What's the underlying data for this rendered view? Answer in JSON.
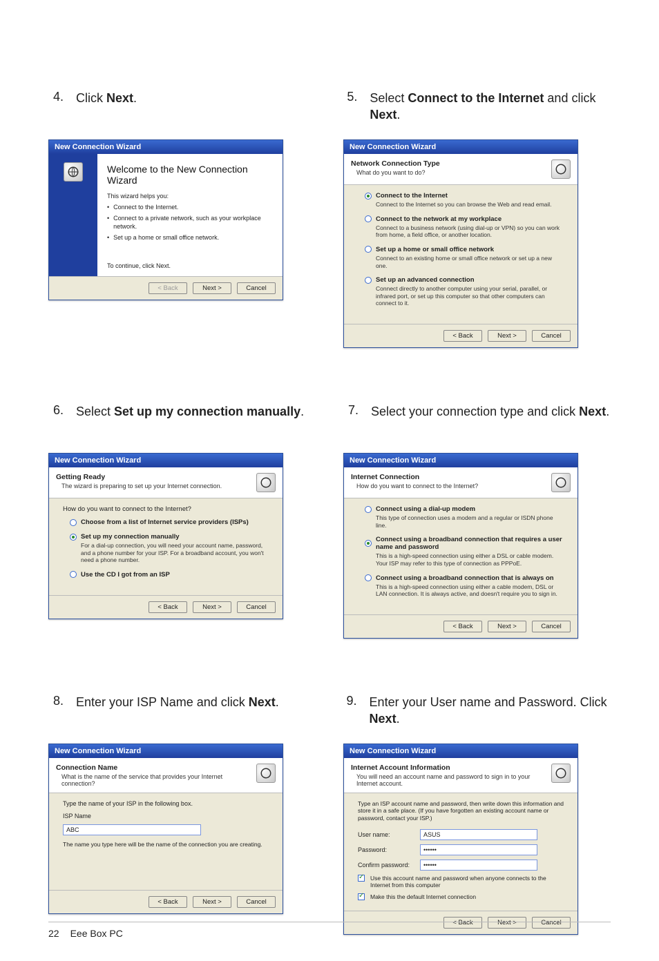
{
  "footer": {
    "page": "22",
    "title": "Eee Box PC"
  },
  "buttons": {
    "back": "< Back",
    "next": "Next >",
    "cancel": "Cancel"
  },
  "wizard_title": "New Connection Wizard",
  "steps": {
    "s4": {
      "num": "4.",
      "text_pre": "Click ",
      "bold": "Next",
      "text_post": "."
    },
    "s5": {
      "num": "5.",
      "text_pre": "Select ",
      "bold": "Connect to the Internet",
      "text_mid": " and click ",
      "bold2": "Next",
      "text_post": "."
    },
    "s6": {
      "num": "6.",
      "text_pre": "Select ",
      "bold": "Set up my connection manually",
      "text_post": "."
    },
    "s7": {
      "num": "7.",
      "text_pre": "Select your connection type and click ",
      "bold": "Next",
      "text_post": "."
    },
    "s8": {
      "num": "8.",
      "text_pre": "Enter your ISP Name and click ",
      "bold": "Next",
      "text_post": "."
    },
    "s9": {
      "num": "9.",
      "text_pre": "Enter your User name and Password. Click ",
      "bold": "Next",
      "text_post": "."
    }
  },
  "dlg4": {
    "title": "Welcome to the New Connection Wizard",
    "intro": "This wizard helps you:",
    "items": [
      "Connect to the Internet.",
      "Connect to a private network, such as your workplace network.",
      "Set up a home or small office network."
    ],
    "cont": "To continue, click Next."
  },
  "dlg5": {
    "hd_title": "Network Connection Type",
    "hd_sub": "What do you want to do?",
    "opts": [
      {
        "label": "Connect to the Internet",
        "desc": "Connect to the Internet so you can browse the Web and read email.",
        "sel": true
      },
      {
        "label": "Connect to the network at my workplace",
        "desc": "Connect to a business network (using dial-up or VPN) so you can work from home, a field office, or another location.",
        "sel": false
      },
      {
        "label": "Set up a home or small office network",
        "desc": "Connect to an existing home or small office network or set up a new one.",
        "sel": false
      },
      {
        "label": "Set up an advanced connection",
        "desc": "Connect directly to another computer using your serial, parallel, or infrared port, or set up this computer so that other computers can connect to it.",
        "sel": false
      }
    ]
  },
  "dlg6": {
    "hd_title": "Getting Ready",
    "hd_sub": "The wizard is preparing to set up your Internet connection.",
    "q": "How do you want to connect to the Internet?",
    "opts": [
      {
        "label": "Choose from a list of Internet service providers (ISPs)",
        "desc": "",
        "sel": false
      },
      {
        "label": "Set up my connection manually",
        "desc": "For a dial-up connection, you will need your account name, password, and a phone number for your ISP. For a broadband account, you won't need a phone number.",
        "sel": true
      },
      {
        "label": "Use the CD I got from an ISP",
        "desc": "",
        "sel": false
      }
    ]
  },
  "dlg7": {
    "hd_title": "Internet Connection",
    "hd_sub": "How do you want to connect to the Internet?",
    "opts": [
      {
        "label": "Connect using a dial-up modem",
        "desc": "This type of connection uses a modem and a regular or ISDN phone line.",
        "sel": false
      },
      {
        "label": "Connect using a broadband connection that requires a user name and password",
        "desc": "This is a high-speed connection using either a DSL or cable modem. Your ISP may refer to this type of connection as PPPoE.",
        "sel": true
      },
      {
        "label": "Connect using a broadband connection that is always on",
        "desc": "This is a high-speed connection using either a cable modem, DSL or LAN connection. It is always active, and doesn't require you to sign in.",
        "sel": false
      }
    ]
  },
  "dlg8": {
    "hd_title": "Connection Name",
    "hd_sub": "What is the name of the service that provides your Internet connection?",
    "prompt": "Type the name of your ISP in the following box.",
    "field_label": "ISP Name",
    "value": "ABC",
    "hint": "The name you type here will be the name of the connection you are creating."
  },
  "dlg9": {
    "hd_title": "Internet Account Information",
    "hd_sub": "You will need an account name and password to sign in to your Internet account.",
    "intro": "Type an ISP account name and password, then write down this information and store it in a safe place. (If you have forgotten an existing account name or password, contact your ISP.)",
    "user_label": "User name:",
    "user_val": "ASUS",
    "pass_label": "Password:",
    "pass_val": "••••••",
    "conf_label": "Confirm password:",
    "conf_val": "••••••",
    "chk1": "Use this account  name and password when anyone connects to the Internet from this computer",
    "chk2": "Make this the default Internet connection"
  }
}
